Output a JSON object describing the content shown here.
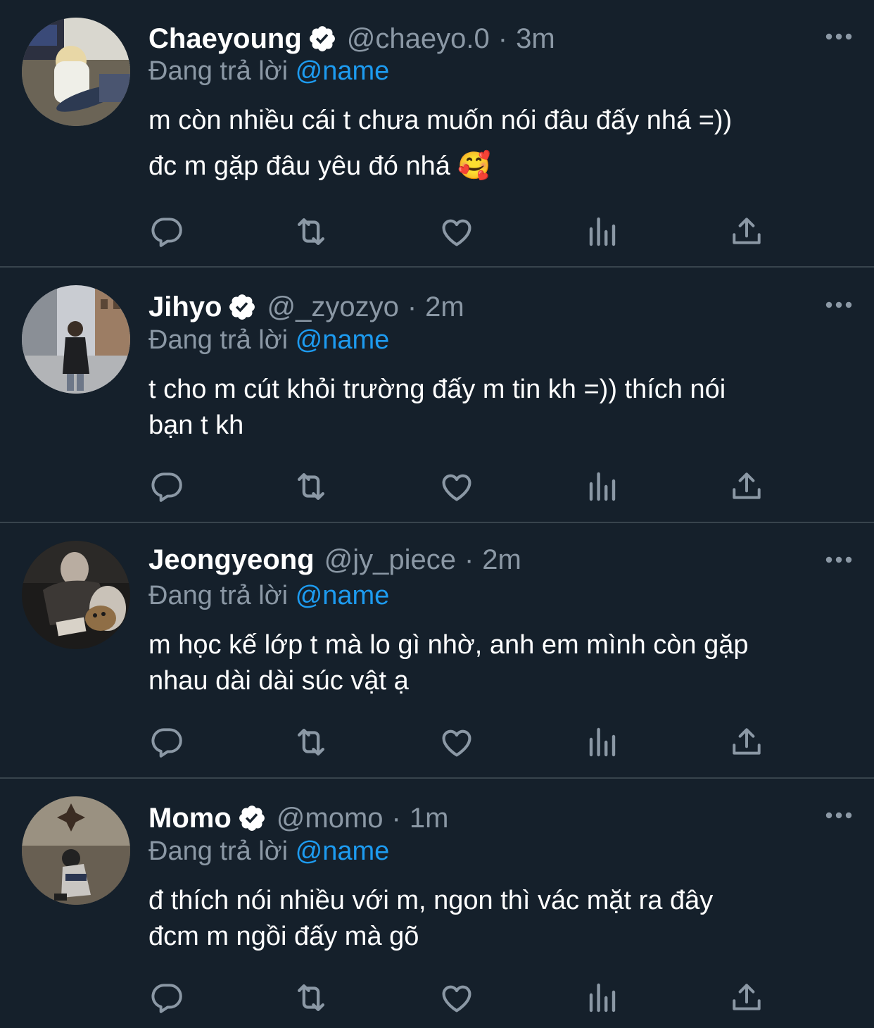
{
  "colors": {
    "background": "#15202b",
    "divider": "#38444d",
    "secondary_text": "#8b98a5",
    "mention": "#1d9bf0",
    "icon": "#8b98a5"
  },
  "replying_label": "Đang trả lời",
  "tweets": [
    {
      "name": "Chaeyoung",
      "verified": true,
      "handle": "@chaeyo.0",
      "separator": "·",
      "time": "3m",
      "reply_to": "@name",
      "text_line1": "m còn nhiều cái t chưa muốn nói đâu đấy nhá =))",
      "text_line2": "đc m gặp đâu yêu đó nhá 🥰"
    },
    {
      "name": "Jihyo",
      "verified": true,
      "handle": "@_zyozyo",
      "separator": "·",
      "time": "2m",
      "reply_to": "@name",
      "text_line1": "t cho m cút khỏi trường đấy m tin kh =)) thích nói",
      "text_line2": "bạn t kh"
    },
    {
      "name": "Jeongyeong",
      "verified": false,
      "handle": "@jy_piece",
      "separator": "·",
      "time": "2m",
      "reply_to": "@name",
      "text_line1": "m học kế lớp t mà lo gì nhờ, anh em mình còn gặp",
      "text_line2": "nhau dài dài súc vật ạ"
    },
    {
      "name": "Momo",
      "verified": true,
      "handle": "@momo",
      "separator": "·",
      "time": "1m",
      "reply_to": "@name",
      "text_line1": "đ thích nói nhiều với m, ngon thì vác mặt ra đây",
      "text_line2": "đcm m ngồi đấy mà gõ"
    }
  ],
  "icons": {
    "reply": "speech-bubble-icon",
    "retweet": "retweet-icon",
    "like": "heart-icon",
    "views": "bar-chart-icon",
    "share": "share-upload-icon",
    "more": "more-dots-icon",
    "verified": "verified-badge-icon"
  }
}
